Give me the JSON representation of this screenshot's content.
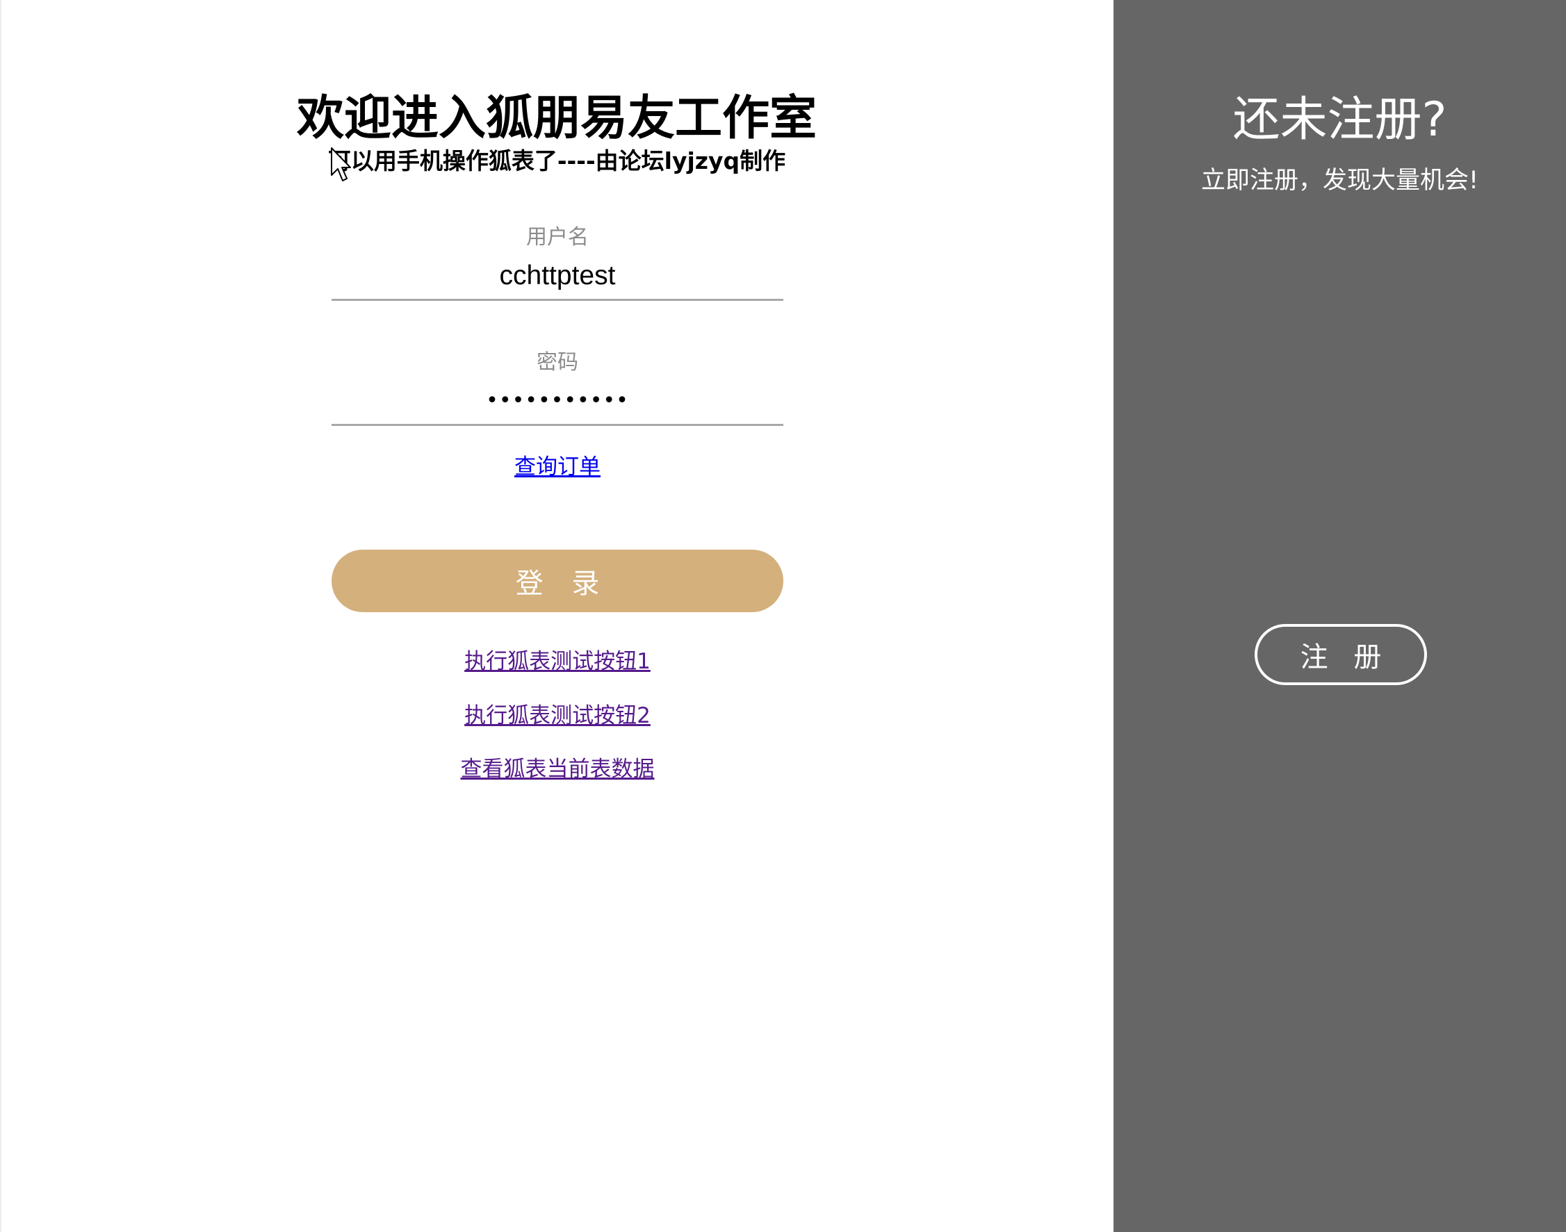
{
  "login": {
    "title": "欢迎进入狐朋易友工作室",
    "subtitle": "可以用手机操作狐表了----由论坛lyjzyq制作",
    "username": {
      "label": "用户名",
      "value": "cchttptest"
    },
    "password": {
      "label": "密码",
      "masked_value": "•••••••••••"
    },
    "order_link": "查询订单",
    "login_button": "登 录",
    "links": {
      "test1": "执行狐表测试按钮1",
      "test2": "执行狐表测试按钮2",
      "view": "查看狐表当前表数据"
    }
  },
  "signup": {
    "title": "还未注册?",
    "description": "立即注册，发现大量机会!",
    "button": "注 册"
  },
  "colors": {
    "login_button_bg": "#d4b07c",
    "signup_panel_bg": "#666666",
    "link_unvisited": "#0000ee",
    "link_visited": "#551a8b"
  },
  "icons": {
    "cursor": "mouse-pointer-icon"
  }
}
